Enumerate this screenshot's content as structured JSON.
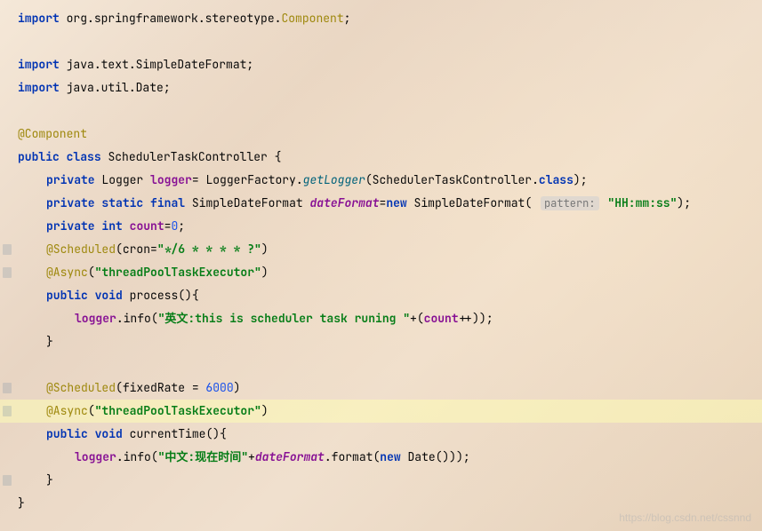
{
  "code": {
    "import1": {
      "kw": "import",
      "pkg": "org.springframework.stereotype.",
      "cls": "Component",
      "semi": ";"
    },
    "import2": {
      "kw": "import",
      "pkg": "java.text.SimpleDateFormat;"
    },
    "import3": {
      "kw": "import",
      "pkg": "java.util.Date;"
    },
    "anno_component": "@Component",
    "class_decl": {
      "kw1": "public",
      "kw2": "class",
      "name": "SchedulerTaskController",
      "brace": " {"
    },
    "logger_line": {
      "kw": "private",
      "type": "Logger",
      "field": "logger",
      "eq": "= LoggerFactory.",
      "method": "getLogger",
      "args": "(SchedulerTaskController.",
      "kw2": "class",
      "end": ");"
    },
    "dateformat_line": {
      "kw1": "private",
      "kw2": "static",
      "kw3": "final",
      "type": "SimpleDateFormat",
      "field": "dateFormat",
      "eq": "=",
      "kw4": "new",
      "ctor": "SimpleDateFormat(",
      "hint": "pattern:",
      "str": "\"HH:mm:ss\"",
      "end": ");"
    },
    "count_line": {
      "kw1": "private",
      "kw2": "int",
      "field": "count",
      "eq": "=",
      "num": "0",
      "semi": ";"
    },
    "scheduled1": {
      "anno": "@Scheduled",
      "open": "(cron=",
      "str": "\"*/6 * * * * ?\"",
      "close": ")"
    },
    "async1": {
      "anno": "@Async",
      "open": "(",
      "str": "\"threadPoolTaskExecutor\"",
      "close": ")"
    },
    "process_decl": {
      "kw1": "public",
      "kw2": "void",
      "name": "process",
      "parens": "(){"
    },
    "process_body": {
      "field": "logger",
      "dot": ".info(",
      "str": "\"英文:this is scheduler task runing \"",
      "plus": "+(",
      "cnt": "count",
      "pp": "++));"
    },
    "close_brace": "}",
    "scheduled2": {
      "anno": "@Scheduled",
      "open": "(fixedRate = ",
      "num": "6000",
      "close": ")"
    },
    "async2": {
      "anno": "@Async",
      "open": "(",
      "str": "\"threadPoolTaskExecutor\"",
      "close": ")"
    },
    "currenttime_decl": {
      "kw1": "public",
      "kw2": "void",
      "name": "currentTime",
      "parens": "(){"
    },
    "currenttime_body": {
      "field": "logger",
      "dot": ".info(",
      "str": "\"中文:现在时间\"",
      "plus": "+",
      "df": "dateFormat",
      "fmt": ".format(",
      "kw": "new",
      "date": " Date()));"
    }
  },
  "watermark": "https://blog.csdn.net/cssnnd"
}
